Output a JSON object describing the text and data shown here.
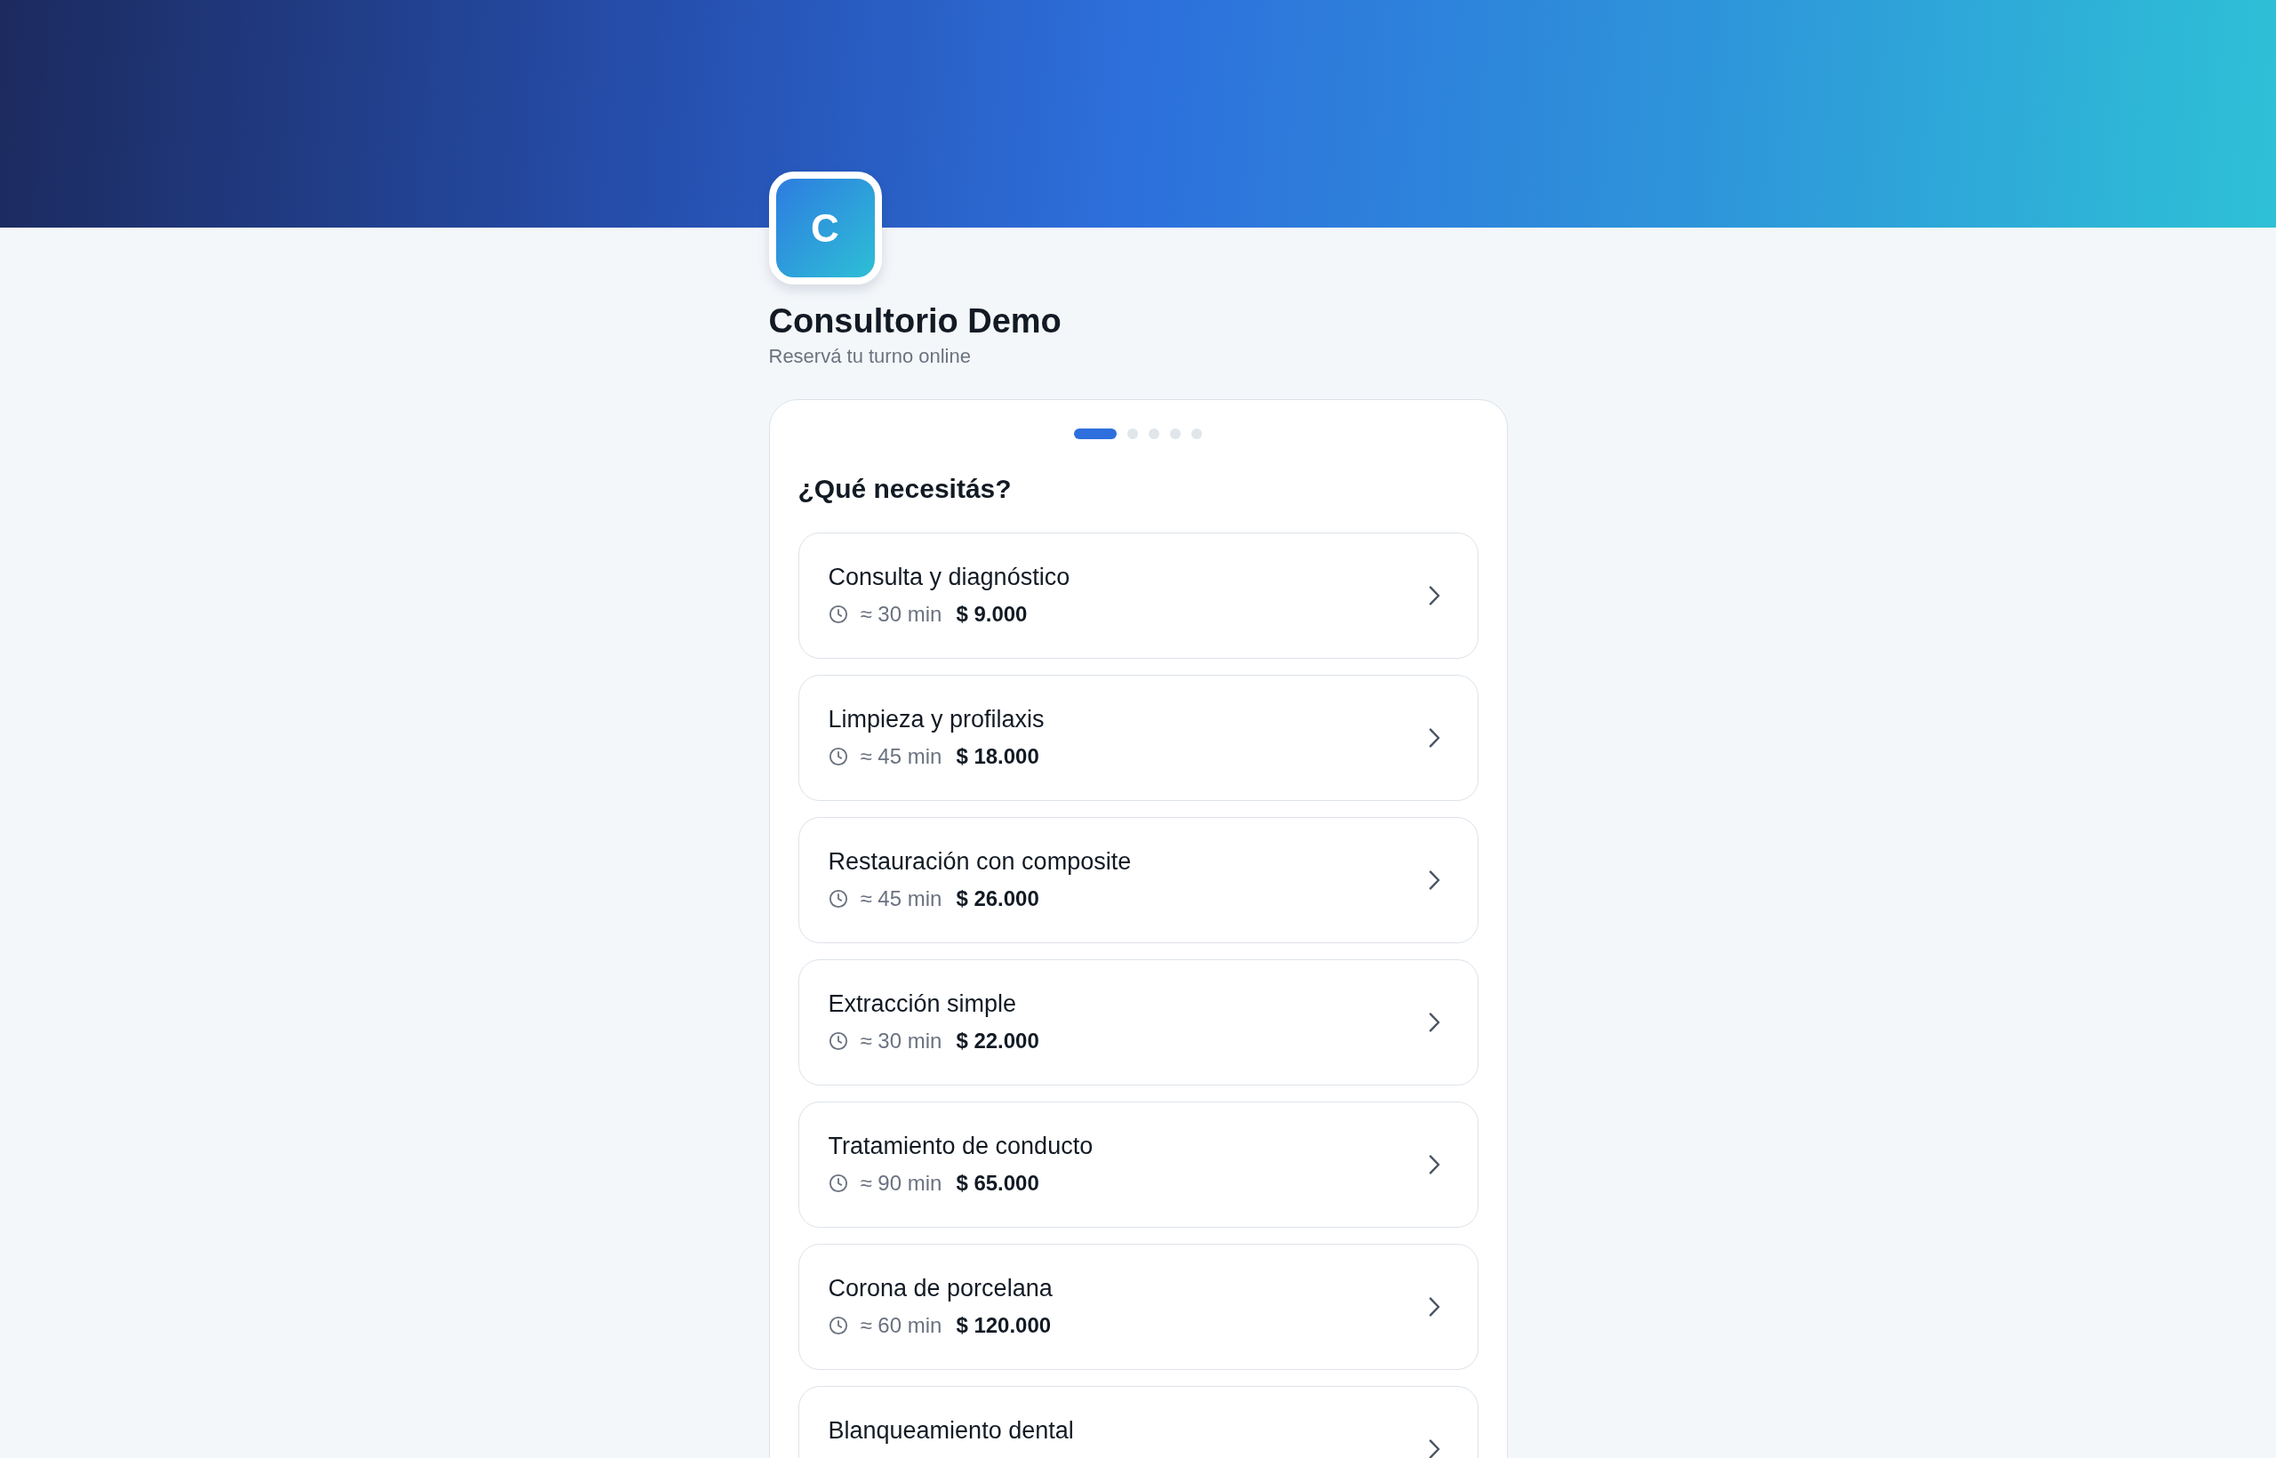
{
  "brand": {
    "logo_letter": "C",
    "name": "Consultorio Demo",
    "tagline": "Reservá tu turno online"
  },
  "steps": [
    {
      "selected": true
    },
    {
      "selected": false
    },
    {
      "selected": false
    },
    {
      "selected": false
    },
    {
      "selected": false
    }
  ],
  "heading": "¿Qué necesitás?",
  "services": [
    {
      "name": "Consulta y diagnóstico",
      "duration": "≈ 30 min",
      "price": "$ 9.000"
    },
    {
      "name": "Limpieza y profilaxis",
      "duration": "≈ 45 min",
      "price": "$ 18.000"
    },
    {
      "name": "Restauración con composite",
      "duration": "≈ 45 min",
      "price": "$ 26.000"
    },
    {
      "name": "Extracción simple",
      "duration": "≈ 30 min",
      "price": "$ 22.000"
    },
    {
      "name": "Tratamiento de conducto",
      "duration": "≈ 90 min",
      "price": "$ 65.000"
    },
    {
      "name": "Corona de porcelana",
      "duration": "≈ 60 min",
      "price": "$ 120.000"
    },
    {
      "name": "Blanqueamiento dental"
    }
  ]
}
